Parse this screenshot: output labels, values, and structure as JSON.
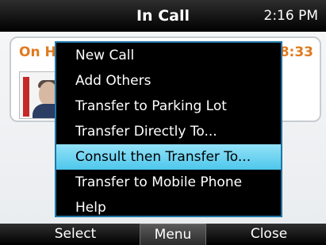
{
  "status_bar": {
    "title": "In Call",
    "time": "2:16 PM"
  },
  "call": {
    "status": "On H",
    "timer": "8:33"
  },
  "menu": {
    "items": [
      {
        "label": "New Call"
      },
      {
        "label": "Add Others"
      },
      {
        "label": "Transfer to Parking Lot"
      },
      {
        "label": "Transfer Directly To..."
      },
      {
        "label": "Consult then Transfer To..."
      },
      {
        "label": "Transfer to Mobile Phone"
      },
      {
        "label": "Help"
      }
    ],
    "selected_index": 4
  },
  "softkeys": {
    "select": "Select",
    "menu": "Menu",
    "close": "Close"
  },
  "colors": {
    "accent": "#4ec7ec",
    "status_text": "#e07a1f",
    "menu_border": "#1f77a8"
  }
}
